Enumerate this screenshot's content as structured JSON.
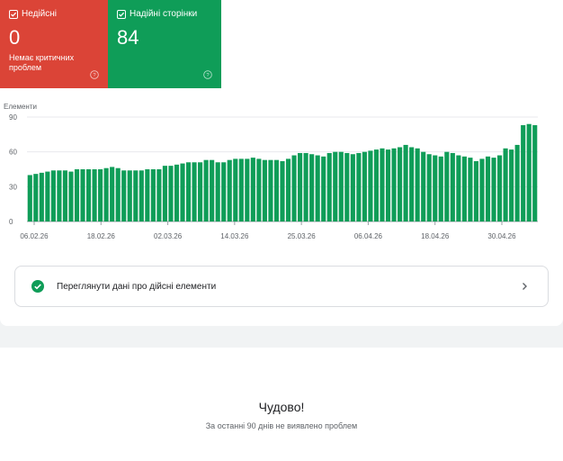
{
  "tiles": {
    "invalid": {
      "label": "Недійсні",
      "count": "0",
      "subtitle": "Немає критичних проблем",
      "color": "#db4437"
    },
    "valid": {
      "label": "Надійні сторінки",
      "count": "84",
      "color": "#0f9d58"
    }
  },
  "chart_data": {
    "type": "bar",
    "ylabel": "Елементи",
    "ylim": [
      0,
      90
    ],
    "yticks": [
      "0",
      "30",
      "60",
      "90"
    ],
    "x_tick_labels": [
      "06.02.26",
      "18.02.26",
      "02.03.26",
      "14.03.26",
      "25.03.26",
      "06.04.26",
      "18.04.26",
      "30.04.26"
    ],
    "bar_color": "#0f9d58",
    "values": [
      40,
      41,
      42,
      43,
      44,
      44,
      44,
      43,
      45,
      45,
      45,
      45,
      45,
      46,
      47,
      46,
      44,
      44,
      44,
      44,
      45,
      45,
      45,
      48,
      48,
      49,
      50,
      51,
      51,
      51,
      53,
      53,
      51,
      51,
      53,
      54,
      54,
      54,
      55,
      54,
      53,
      53,
      53,
      52,
      54,
      57,
      59,
      59,
      58,
      57,
      56,
      59,
      60,
      60,
      59,
      58,
      59,
      60,
      61,
      62,
      63,
      62,
      63,
      64,
      66,
      64,
      63,
      60,
      58,
      57,
      56,
      60,
      59,
      57,
      56,
      55,
      52,
      54,
      56,
      55,
      57,
      63,
      62,
      66,
      83,
      84,
      83
    ]
  },
  "action": {
    "label": "Переглянути дані про дійсні елементи"
  },
  "summary": {
    "title": "Чудово!",
    "subtitle": "За останні 90 днів не виявлено проблем"
  }
}
